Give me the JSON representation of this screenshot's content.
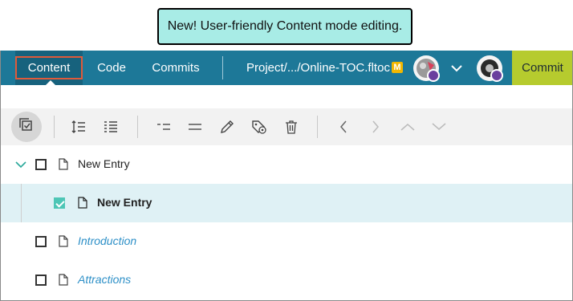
{
  "callout": {
    "text": "New! User-friendly Content mode editing."
  },
  "topbar": {
    "tabs": [
      {
        "label": "Content",
        "active": true
      },
      {
        "label": "Code"
      },
      {
        "label": "Commits"
      }
    ],
    "project_path": "Project/.../Online-TOC.fltoc",
    "status_badge": "M",
    "commit_label": "Commit"
  },
  "toolbar": {
    "icons": [
      "select-mode-icon",
      "indent-icon",
      "outdent-icon",
      "collapse-list-icon",
      "list-icon",
      "pencil-icon",
      "tag-settings-icon",
      "trash-icon",
      "chevron-left-icon",
      "chevron-right-icon",
      "chevron-up-icon",
      "chevron-down-icon"
    ]
  },
  "tree": {
    "rows": [
      {
        "label": "New Entry",
        "expanded": true,
        "checked": false
      },
      {
        "label": "New Entry",
        "checked": true,
        "selected": true
      },
      {
        "label": "Introduction",
        "checked": false
      },
      {
        "label": "Attractions",
        "checked": false
      }
    ]
  },
  "colors": {
    "topbar": "#1d7898",
    "active_tab": "#17627d",
    "commit_button": "#b6cb2e",
    "callout": "#a8ece6",
    "link": "#2c8fc7",
    "selected_row": "#dff1f5",
    "checkbox_checked": "#4ec6b6"
  }
}
